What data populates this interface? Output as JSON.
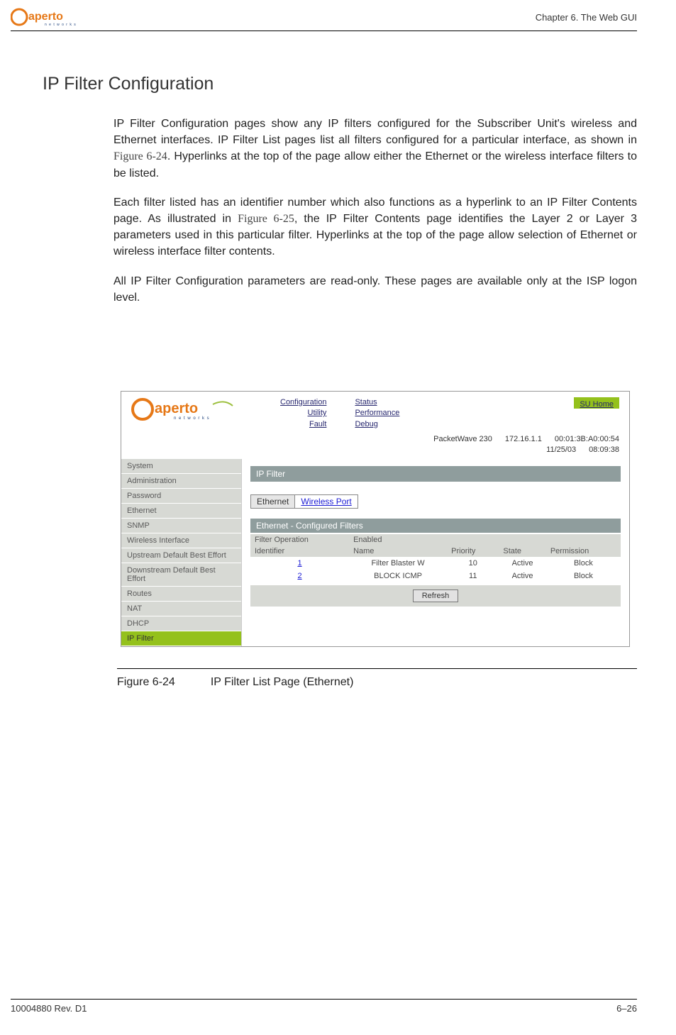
{
  "header": {
    "chapter_line": "Chapter 6.  The Web GUI"
  },
  "section": {
    "title": "IP Filter Configuration",
    "p1a": "IP Filter Configuration pages show any IP filters configured for the Subscriber Unit's wireless and Ethernet interfaces. IP Filter List pages list all filters configured for a particular interface, as shown in ",
    "p1_link": "Figure 6-24",
    "p1b": ". Hyperlinks at the top of the page allow either the Ethernet or the wireless interface filters to be listed.",
    "p2a": "Each filter listed has an identifier number which also functions as a hyperlink to an IP Filter Contents page. As illustrated in ",
    "p2_link": "Figure 6-25",
    "p2b": ", the IP Filter Contents page identifies the Layer 2 or Layer 3 parameters used in this particular filter. Hyperlinks at the top of the page allow selection of Ethernet or wireless interface filter contents.",
    "p3": "All IP Filter Configuration parameters are read-only. These pages are available only at the ISP logon level."
  },
  "screenshot": {
    "topnav_col1": [
      "Configuration",
      "Utility",
      "Fault"
    ],
    "topnav_col2": [
      "Status",
      "Performance",
      "Debug"
    ],
    "su_home": "SU Home",
    "info_line1": [
      "PacketWave 230",
      "172.16.1.1",
      "00:01:3B:A0:00:54"
    ],
    "info_line2": [
      "11/25/03",
      "08:09:38"
    ],
    "sidebar": [
      "System",
      "Administration",
      "Password",
      "Ethernet",
      "SNMP",
      "Wireless Interface",
      "Upstream Default Best Effort",
      "Downstream Default Best Effort",
      "Routes",
      "NAT",
      "DHCP",
      "IP Filter"
    ],
    "sidebar_active_index": 11,
    "banner": "IP Filter",
    "tabs": {
      "ethernet": "Ethernet",
      "wireless": "Wireless Port"
    },
    "subbanner": "Ethernet   - Configured Filters",
    "summary": {
      "label": "Filter Operation",
      "value": "Enabled"
    },
    "columns": [
      "Identifier",
      "Name",
      "Priority",
      "State",
      "Permission"
    ],
    "rows": [
      {
        "id": "1",
        "name": "Filter Blaster W",
        "priority": "10",
        "state": "Active",
        "permission": "Block"
      },
      {
        "id": "2",
        "name": "BLOCK ICMP",
        "priority": "11",
        "state": "Active",
        "permission": "Block"
      }
    ],
    "refresh": "Refresh"
  },
  "figure": {
    "num": "Figure 6-24",
    "caption": "IP Filter List Page (Ethernet)"
  },
  "footer": {
    "left": "10004880 Rev. D1",
    "right": "6–26"
  }
}
